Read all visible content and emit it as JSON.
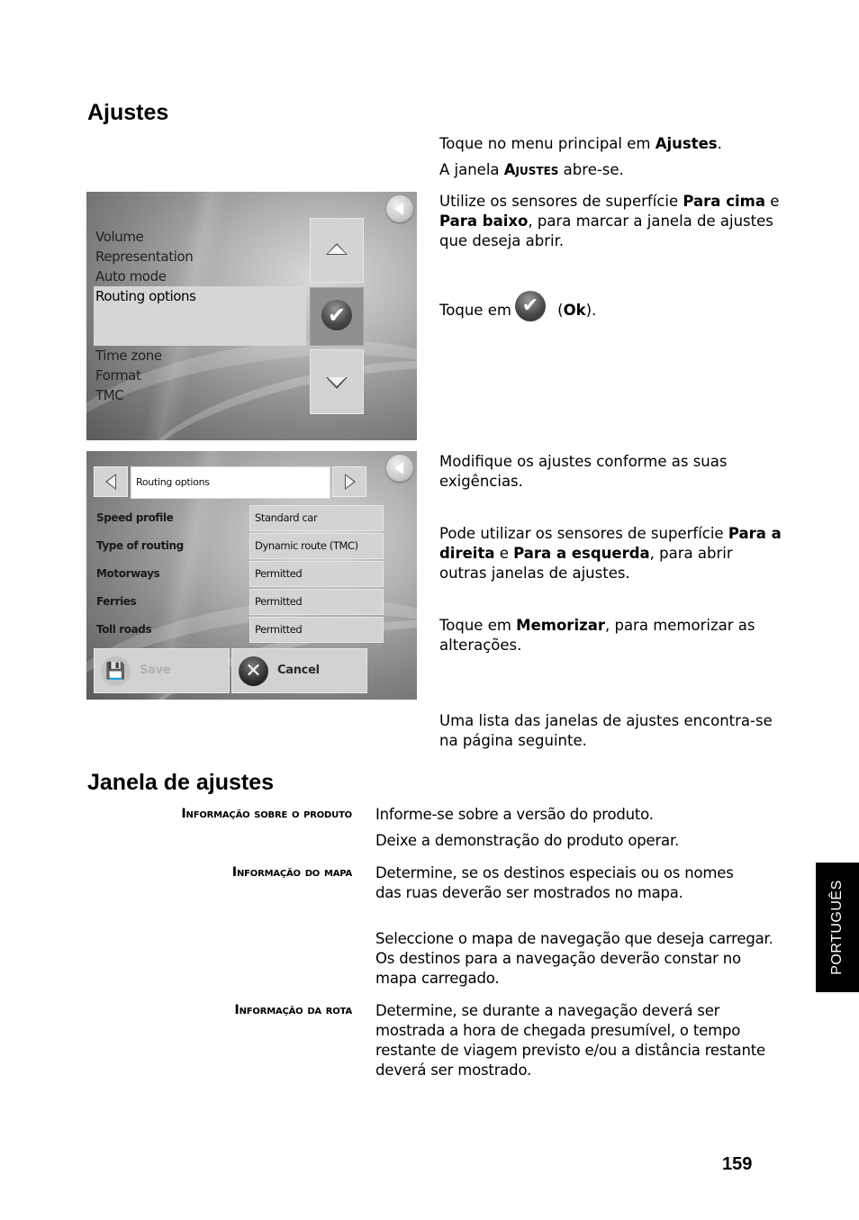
{
  "section1": {
    "heading": "Ajustes",
    "p1_pre": "Toque no menu principal em ",
    "p1_bold": "Ajustes",
    "p1_post": ".",
    "p2_pre": "A janela ",
    "p2_sc": "Ajustes",
    "p2_post": " abre-se.",
    "p3_pre": "Utilize os sensores de superfície ",
    "p3_bold1": "Para cima",
    "p3_mid": " e ",
    "p3_bold2": "Para baixo",
    "p3_post": ", para marcar a janela de ajustes que deseja abrir.",
    "p4_pre": "Toque em",
    "p4_open": " (",
    "p4_bold": "Ok",
    "p4_post": ").",
    "p5": "Modifique os ajustes conforme as suas exigências.",
    "p6_pre": "Pode utilizar os sensores de superfície ",
    "p6_bold1": "Para a direita",
    "p6_mid": " e ",
    "p6_bold2": "Para a esquerda",
    "p6_post": ", para abrir outras janelas de ajustes.",
    "p7_pre": "Toque em ",
    "p7_bold": "Memorizar",
    "p7_post": ", para memorizar as alterações.",
    "p8": "Uma lista das janelas de ajustes encontra-se na página seguinte."
  },
  "screen1": {
    "menu_items_above": [
      "Volume",
      "Representation",
      "Auto mode"
    ],
    "selected_item": "Routing options",
    "menu_items_below": [
      "Time zone",
      "Format",
      "TMC"
    ],
    "ok_glyph": "✔"
  },
  "screen2": {
    "title": "Routing options",
    "options": [
      {
        "label": "Speed profile",
        "value": "Standard car"
      },
      {
        "label": "Type of routing",
        "value": "Dynamic route (TMC)"
      },
      {
        "label": "Motorways",
        "value": "Permitted"
      },
      {
        "label": "Ferries",
        "value": "Permitted"
      },
      {
        "label": "Toll roads",
        "value": "Permitted"
      }
    ],
    "save_label": "Save",
    "cancel_label": "Cancel",
    "save_glyph": "💾",
    "cancel_glyph": "✕"
  },
  "section2": {
    "heading": "Janela de ajustes",
    "entries": [
      {
        "term": "Informação sobre o produto",
        "defs": [
          "Informe-se sobre a versão do produto.",
          "Deixe a demonstração do produto operar."
        ]
      },
      {
        "term": "Informação do mapa",
        "defs": [
          "Determine, se os destinos especiais ou os nomes das ruas deverão ser mostrados no mapa.",
          "Seleccione o mapa de navegação que deseja carregar. Os destinos para a navegação deverão constar no mapa carregado."
        ]
      },
      {
        "term": "Informação da rota",
        "defs": [
          "Determine, se durante a navegação deverá ser mostrada a hora de chegada presumível, o tempo restante de viagem previsto e/ou a distância restante deverá ser mostrado."
        ]
      }
    ]
  },
  "footer": {
    "language_tab": "PORTUGUÊS",
    "page_number": "159"
  }
}
